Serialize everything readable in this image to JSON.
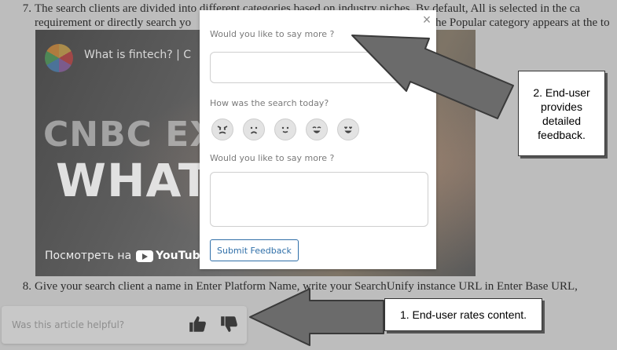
{
  "document": {
    "step7_number": "7.",
    "step7_line1": "The search clients are divided into different categories based on industry niches. By default, All is selected in the ca",
    "step7_line2_start": "requirement or directly search yo",
    "step7_line2_end": "he Popular category appears at the to",
    "step8_number": "8.",
    "step8_line": "Give your search client a name in Enter Platform Name, write your SearchUnify instance URL in Enter Base URL,"
  },
  "video": {
    "title": "What is fintech? | C",
    "overlay_line1": "CNBC EXPLA",
    "overlay_line2": "WHAT IS",
    "watch_on": "Посмотреть на",
    "youtube": "YouTube"
  },
  "feedback_modal": {
    "close_symbol": "×",
    "question_top": "Would you like to say more ?",
    "search_question": "How was the search today?",
    "question_bottom": "Would you like to say more ?",
    "ratings": [
      "angry-face-icon",
      "sad-face-icon",
      "neutral-smile-icon",
      "happy-face-icon",
      "love-face-icon"
    ],
    "submit_label": "Submit Feedback"
  },
  "callouts": {
    "end_user_feedback": "2. End-user provides detailed feedback.",
    "end_user_rates": "1. End-user rates content."
  },
  "helpful_bar": {
    "question": "Was this article helpful?",
    "thumbs_up": "thumbs-up-icon",
    "thumbs_down": "thumbs-down-icon"
  },
  "colors": {
    "backdrop": "#bdbdbd",
    "accent": "#2f6fa8",
    "arrow": "#6b6b6b"
  }
}
